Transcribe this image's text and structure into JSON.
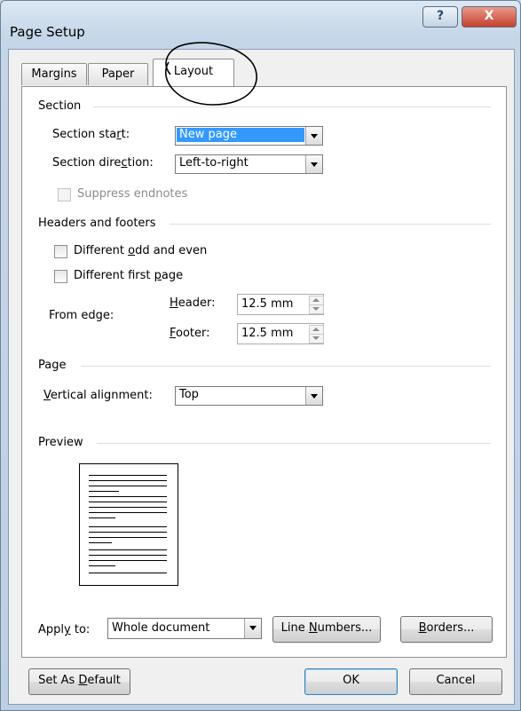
{
  "window": {
    "title": "Page Setup",
    "help_glyph": "?",
    "close_glyph": "X"
  },
  "tabs": [
    {
      "label": "Margins"
    },
    {
      "label": "Paper"
    },
    {
      "label": "Layout",
      "active": true
    }
  ],
  "section": {
    "heading": "Section",
    "start_label": "Section start:",
    "start_value": "New page",
    "direction_label": "Section direction:",
    "direction_value": "Left-to-right",
    "suppress_label": "Suppress endnotes",
    "suppress_checked": false
  },
  "headers_footers": {
    "heading": "Headers and footers",
    "odd_even_label": "Different odd and even",
    "odd_even_checked": false,
    "first_page_label": "Different first page",
    "first_page_checked": false,
    "from_edge_label": "From edge:",
    "header_label": "Header:",
    "header_value": "12.5 mm",
    "footer_label": "Footer:",
    "footer_value": "12.5 mm"
  },
  "page": {
    "heading": "Page",
    "vertical_label": "Vertical alignment:",
    "vertical_value": "Top"
  },
  "preview": {
    "heading": "Preview"
  },
  "apply": {
    "label": "Apply to:",
    "value": "Whole document",
    "line_numbers_label": "Line Numbers...",
    "borders_label": "Borders..."
  },
  "footer_buttons": {
    "set_default_label": "Set As Default",
    "ok_label": "OK",
    "cancel_label": "Cancel"
  },
  "colors": {
    "selection": "#3399ff",
    "annotation": "#000000"
  }
}
